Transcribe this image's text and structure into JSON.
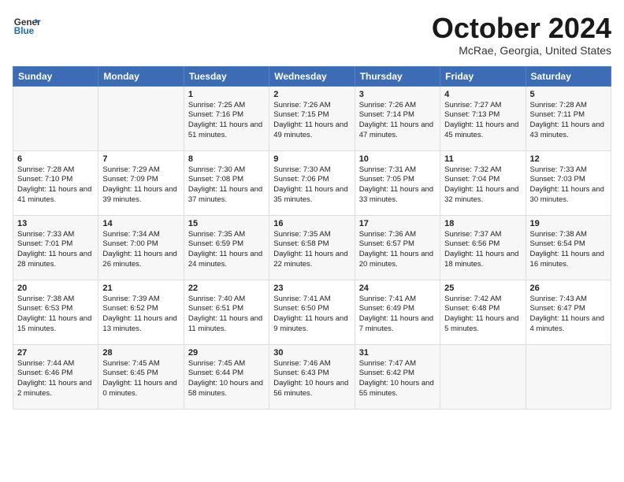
{
  "header": {
    "logo_line1": "General",
    "logo_line2": "Blue",
    "month": "October 2024",
    "location": "McRae, Georgia, United States"
  },
  "weekdays": [
    "Sunday",
    "Monday",
    "Tuesday",
    "Wednesday",
    "Thursday",
    "Friday",
    "Saturday"
  ],
  "weeks": [
    [
      {
        "day": "",
        "info": ""
      },
      {
        "day": "",
        "info": ""
      },
      {
        "day": "1",
        "info": "Sunrise: 7:25 AM\nSunset: 7:16 PM\nDaylight: 11 hours and 51 minutes."
      },
      {
        "day": "2",
        "info": "Sunrise: 7:26 AM\nSunset: 7:15 PM\nDaylight: 11 hours and 49 minutes."
      },
      {
        "day": "3",
        "info": "Sunrise: 7:26 AM\nSunset: 7:14 PM\nDaylight: 11 hours and 47 minutes."
      },
      {
        "day": "4",
        "info": "Sunrise: 7:27 AM\nSunset: 7:13 PM\nDaylight: 11 hours and 45 minutes."
      },
      {
        "day": "5",
        "info": "Sunrise: 7:28 AM\nSunset: 7:11 PM\nDaylight: 11 hours and 43 minutes."
      }
    ],
    [
      {
        "day": "6",
        "info": "Sunrise: 7:28 AM\nSunset: 7:10 PM\nDaylight: 11 hours and 41 minutes."
      },
      {
        "day": "7",
        "info": "Sunrise: 7:29 AM\nSunset: 7:09 PM\nDaylight: 11 hours and 39 minutes."
      },
      {
        "day": "8",
        "info": "Sunrise: 7:30 AM\nSunset: 7:08 PM\nDaylight: 11 hours and 37 minutes."
      },
      {
        "day": "9",
        "info": "Sunrise: 7:30 AM\nSunset: 7:06 PM\nDaylight: 11 hours and 35 minutes."
      },
      {
        "day": "10",
        "info": "Sunrise: 7:31 AM\nSunset: 7:05 PM\nDaylight: 11 hours and 33 minutes."
      },
      {
        "day": "11",
        "info": "Sunrise: 7:32 AM\nSunset: 7:04 PM\nDaylight: 11 hours and 32 minutes."
      },
      {
        "day": "12",
        "info": "Sunrise: 7:33 AM\nSunset: 7:03 PM\nDaylight: 11 hours and 30 minutes."
      }
    ],
    [
      {
        "day": "13",
        "info": "Sunrise: 7:33 AM\nSunset: 7:01 PM\nDaylight: 11 hours and 28 minutes."
      },
      {
        "day": "14",
        "info": "Sunrise: 7:34 AM\nSunset: 7:00 PM\nDaylight: 11 hours and 26 minutes."
      },
      {
        "day": "15",
        "info": "Sunrise: 7:35 AM\nSunset: 6:59 PM\nDaylight: 11 hours and 24 minutes."
      },
      {
        "day": "16",
        "info": "Sunrise: 7:35 AM\nSunset: 6:58 PM\nDaylight: 11 hours and 22 minutes."
      },
      {
        "day": "17",
        "info": "Sunrise: 7:36 AM\nSunset: 6:57 PM\nDaylight: 11 hours and 20 minutes."
      },
      {
        "day": "18",
        "info": "Sunrise: 7:37 AM\nSunset: 6:56 PM\nDaylight: 11 hours and 18 minutes."
      },
      {
        "day": "19",
        "info": "Sunrise: 7:38 AM\nSunset: 6:54 PM\nDaylight: 11 hours and 16 minutes."
      }
    ],
    [
      {
        "day": "20",
        "info": "Sunrise: 7:38 AM\nSunset: 6:53 PM\nDaylight: 11 hours and 15 minutes."
      },
      {
        "day": "21",
        "info": "Sunrise: 7:39 AM\nSunset: 6:52 PM\nDaylight: 11 hours and 13 minutes."
      },
      {
        "day": "22",
        "info": "Sunrise: 7:40 AM\nSunset: 6:51 PM\nDaylight: 11 hours and 11 minutes."
      },
      {
        "day": "23",
        "info": "Sunrise: 7:41 AM\nSunset: 6:50 PM\nDaylight: 11 hours and 9 minutes."
      },
      {
        "day": "24",
        "info": "Sunrise: 7:41 AM\nSunset: 6:49 PM\nDaylight: 11 hours and 7 minutes."
      },
      {
        "day": "25",
        "info": "Sunrise: 7:42 AM\nSunset: 6:48 PM\nDaylight: 11 hours and 5 minutes."
      },
      {
        "day": "26",
        "info": "Sunrise: 7:43 AM\nSunset: 6:47 PM\nDaylight: 11 hours and 4 minutes."
      }
    ],
    [
      {
        "day": "27",
        "info": "Sunrise: 7:44 AM\nSunset: 6:46 PM\nDaylight: 11 hours and 2 minutes."
      },
      {
        "day": "28",
        "info": "Sunrise: 7:45 AM\nSunset: 6:45 PM\nDaylight: 11 hours and 0 minutes."
      },
      {
        "day": "29",
        "info": "Sunrise: 7:45 AM\nSunset: 6:44 PM\nDaylight: 10 hours and 58 minutes."
      },
      {
        "day": "30",
        "info": "Sunrise: 7:46 AM\nSunset: 6:43 PM\nDaylight: 10 hours and 56 minutes."
      },
      {
        "day": "31",
        "info": "Sunrise: 7:47 AM\nSunset: 6:42 PM\nDaylight: 10 hours and 55 minutes."
      },
      {
        "day": "",
        "info": ""
      },
      {
        "day": "",
        "info": ""
      }
    ]
  ]
}
